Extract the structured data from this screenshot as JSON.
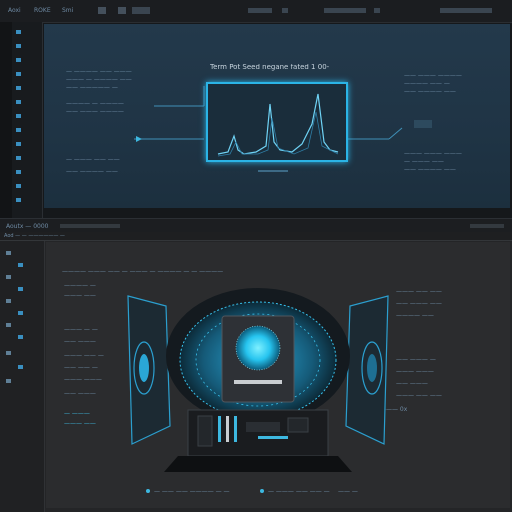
{
  "top": {
    "menu": [
      "Aoxi",
      "ROKE",
      "Smi"
    ],
    "title": "Term Pot Seed  negane fated 1 00-",
    "left_text": [
      "— ———— —— ———",
      "——— — ———— ——",
      "—— ————— —",
      "———— — ————",
      "—— ——— ————",
      "— ——— —— ——",
      "—— ———— ——"
    ],
    "right_text": [
      "—— ——— ————",
      "———— —— —",
      "—— ———— ——",
      "——— ——— ———",
      "— ——— ——",
      "—— ———— ——"
    ],
    "status": "Aoutx — 0000"
  },
  "bottom": {
    "header": "Aod  — — —————— —",
    "info_line": "———— ——— —— — ——— — ———— — — ————",
    "left_items": [
      "———— —",
      "——— ——",
      "——— — —",
      "—— ———",
      "——— —— —",
      "—— —— —",
      "——— ———",
      "—— ———",
      "— ———",
      "——— ——"
    ],
    "right_items": [
      "——— —— ——",
      "—— ——— ——",
      "———— ——",
      "—— ——— —",
      "——— ———",
      "—— ———",
      "——— —— ——"
    ],
    "right_footer": "——— 0x",
    "footer_left": "— —— —— ———— — —",
    "footer_mid": "— ——— —— —— —",
    "footer_right": "—— —"
  },
  "colors": {
    "accent": "#2bb4e6",
    "top_panel": "#22394a",
    "bottom_panel": "#2b2c2e"
  }
}
